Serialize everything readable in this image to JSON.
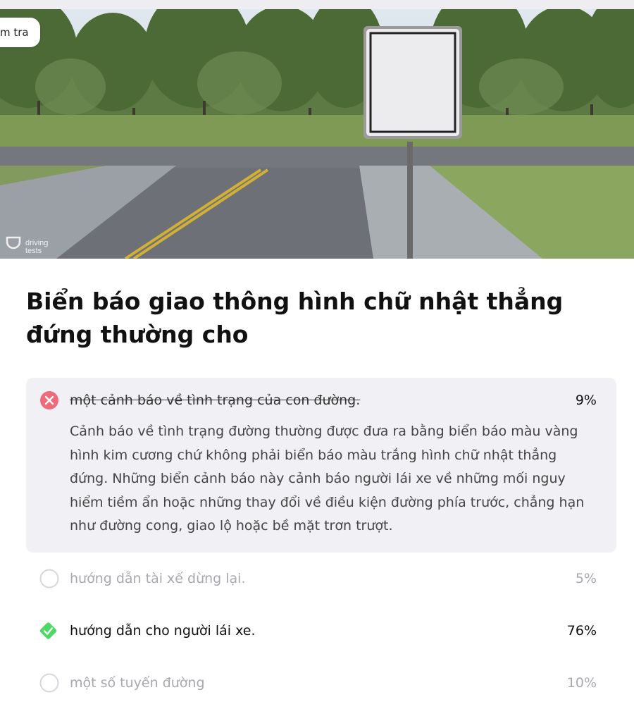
{
  "header": {
    "pill_label": "m tra",
    "watermark": "driving tests"
  },
  "question": {
    "title": "Biển báo giao thông hình chữ nhật thẳng đứng thường cho"
  },
  "answers": [
    {
      "text": "một cảnh báo về tình trạng của con đường.",
      "percent": "9%",
      "state": "wrong",
      "explanation": "Cảnh báo về tình trạng đường thường được đưa ra bằng biển báo màu vàng hình kim cương chứ không phải biển báo màu trắng hình chữ nhật thẳng đứng. Những biển cảnh báo này cảnh báo người lái xe về những mối nguy hiểm tiềm ẩn hoặc những thay đổi về điều kiện đường phía trước, chẳng hạn như đường cong, giao lộ hoặc bề mặt trơn trượt."
    },
    {
      "text": "hướng dẫn tài xế dừng lại.",
      "percent": "5%",
      "state": "unselected"
    },
    {
      "text": "hướng dẫn cho người lái xe.",
      "percent": "76%",
      "state": "correct"
    },
    {
      "text": "một số tuyến đường",
      "percent": "10%",
      "state": "unselected"
    }
  ],
  "colors": {
    "wrong": "#ef6b7b",
    "correct": "#4cd964",
    "muted": "#a8a8ae",
    "panel": "#f1f1f5"
  },
  "icons": [
    "close-icon",
    "radio-empty-icon",
    "check-icon",
    "driving-tests-logo"
  ]
}
